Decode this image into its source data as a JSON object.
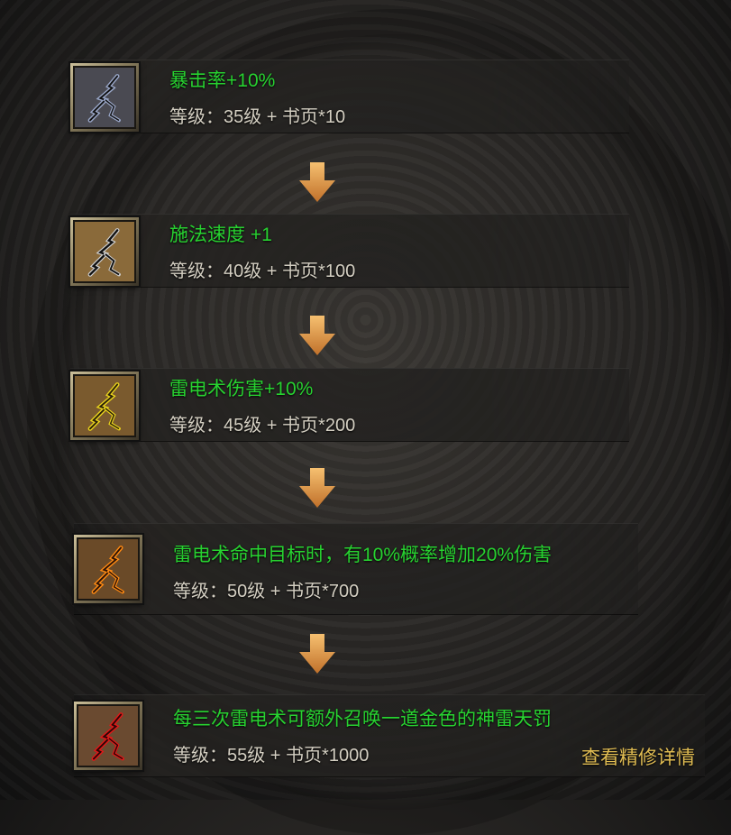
{
  "upgrades": [
    {
      "title": "暴击率+10%",
      "requirement": "等级：35级 + 书页*10",
      "icon": "lightning-rune-icon",
      "glow": "#9aa7c8",
      "bg": "#4a4a52"
    },
    {
      "title": "施法速度 +1",
      "requirement": "等级：40级 + 书页*100",
      "icon": "lightning-rune-icon",
      "glow": "#1a1a1a",
      "bg": "#8a6a3a"
    },
    {
      "title": "雷电术伤害+10%",
      "requirement": "等级：45级 + 书页*200",
      "icon": "lightning-rune-icon",
      "glow": "#e8d21c",
      "bg": "#7a5a2e"
    },
    {
      "title": "雷电术命中目标时，有10%概率增加20%伤害",
      "requirement": "等级：50级 + 书页*700",
      "icon": "lightning-rune-icon",
      "glow": "#ff8a12",
      "bg": "#6a4a28"
    },
    {
      "title": "每三次雷电术可额外召唤一道金色的神雷天罚",
      "requirement": "等级：55级 + 书页*1000",
      "icon": "lightning-rune-icon",
      "glow": "#e01818",
      "bg": "#6a4a30"
    }
  ],
  "details_link": "查看精修详情",
  "colors": {
    "title": "#27d230",
    "requirement": "#d4cfc2",
    "link": "#e0bc52",
    "arrow": "#e8a040"
  }
}
